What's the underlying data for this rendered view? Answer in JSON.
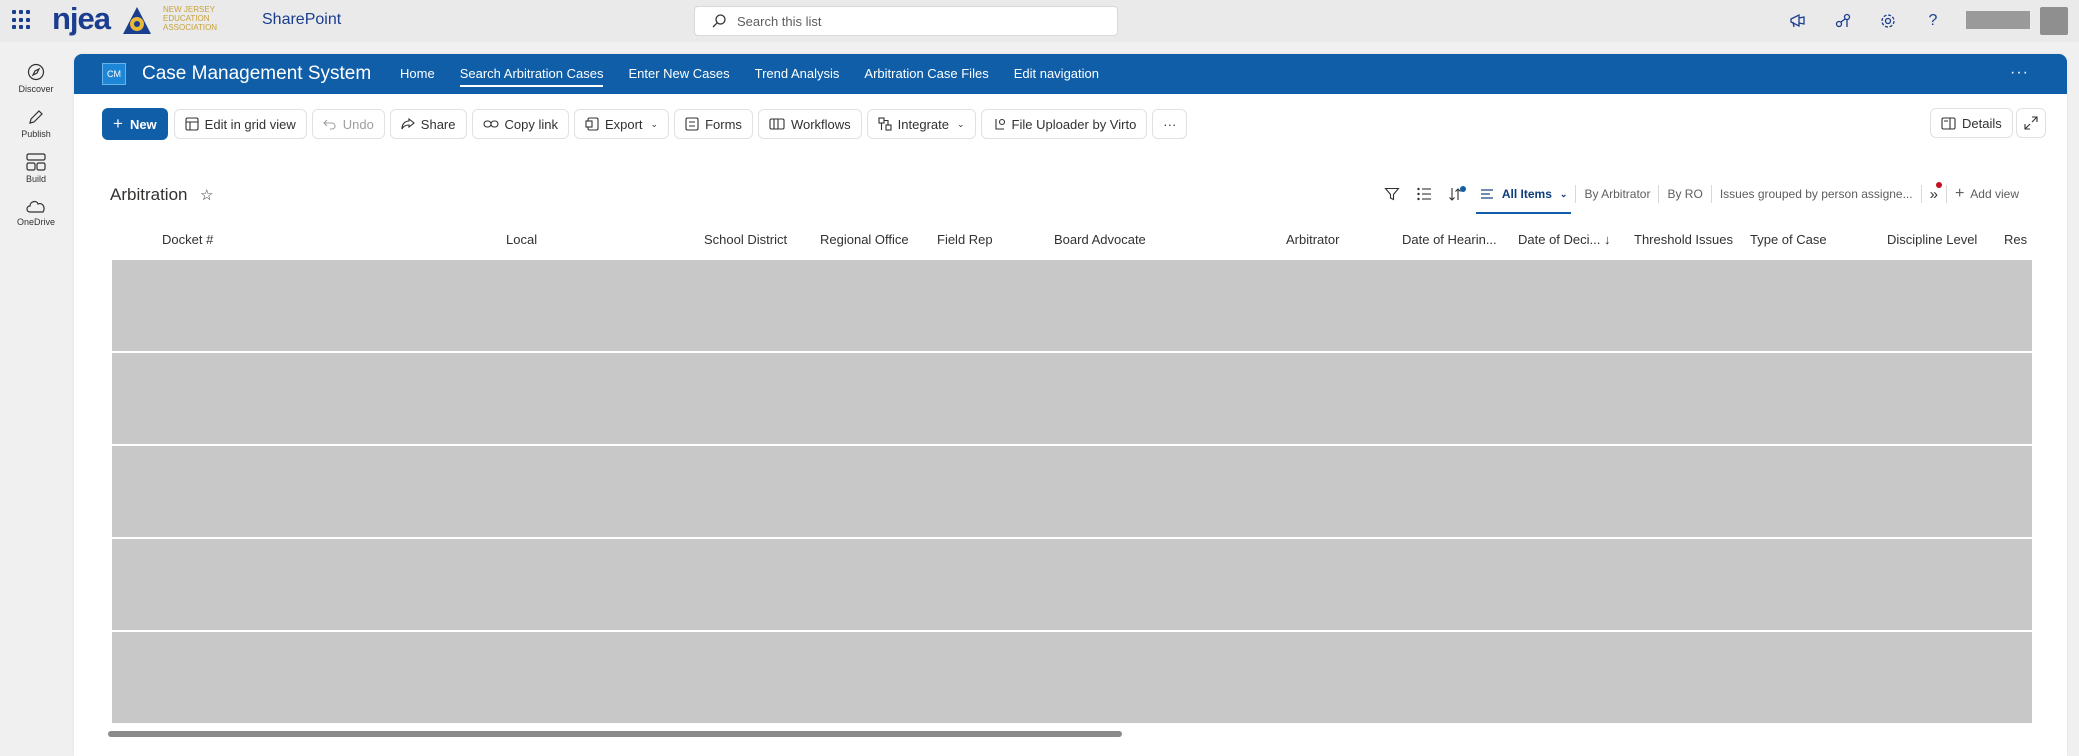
{
  "suitebar": {
    "brand": "njea",
    "logo_sub": [
      "NEW JERSEY",
      "EDUCATION",
      "ASSOCIATION"
    ],
    "app_name": "SharePoint",
    "search_placeholder": "Search this list",
    "icons": [
      "megaphone-icon",
      "share-link-icon",
      "gear-icon",
      "help-icon"
    ]
  },
  "appbar": {
    "items": [
      {
        "label": "Discover",
        "icon": "compass-icon"
      },
      {
        "label": "Publish",
        "icon": "pen-icon"
      },
      {
        "label": "Build",
        "icon": "layout-icon"
      },
      {
        "label": "OneDrive",
        "icon": "cloud-icon"
      }
    ]
  },
  "site": {
    "logo_initials": "CM",
    "title": "Case Management System",
    "nav": [
      {
        "label": "Home",
        "active": false
      },
      {
        "label": "Search Arbitration Cases",
        "active": true
      },
      {
        "label": "Enter New Cases",
        "active": false
      },
      {
        "label": "Trend Analysis",
        "active": false
      },
      {
        "label": "Arbitration Case Files",
        "active": false
      },
      {
        "label": "Edit navigation",
        "active": false
      }
    ],
    "more": "···"
  },
  "commandbar": {
    "new": "New",
    "edit_grid": "Edit in grid view",
    "undo": "Undo",
    "share": "Share",
    "copy_link": "Copy link",
    "export": "Export",
    "forms": "Forms",
    "workflows": "Workflows",
    "integrate": "Integrate",
    "file_uploader": "File Uploader by Virto",
    "more": "···",
    "details": "Details"
  },
  "list": {
    "title": "Arbitration",
    "views": {
      "all_items": "All Items",
      "by_arbitrator": "By Arbitrator",
      "by_ro": "By RO",
      "issues_grouped": "Issues grouped by person assigne...",
      "add_view": "Add view"
    },
    "columns": [
      "Docket #",
      "Local",
      "School District",
      "Regional Office",
      "Field Rep",
      "Board Advocate",
      "Arbitrator",
      "Date of Hearin...",
      "Date of Deci... ↓",
      "Threshold Issues",
      "Type of Case",
      "Discipline Level",
      "Res"
    ],
    "row_count": 5
  },
  "colors": {
    "brand_blue": "#0f5ea7",
    "logo_blue": "#1b3d8f",
    "row_placeholder": "#c8c8c8",
    "notify_red": "#c50f1f",
    "notify_blue": "#0f5ea7"
  }
}
